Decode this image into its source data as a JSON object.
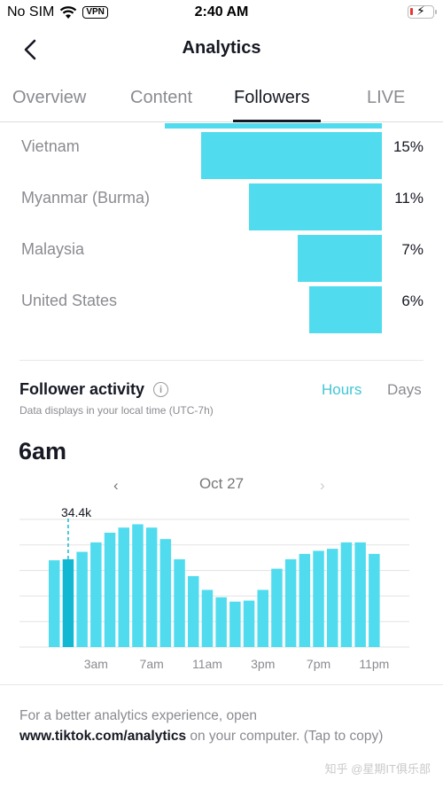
{
  "status_bar": {
    "carrier": "No SIM",
    "wifi_icon": "wifi-icon",
    "vpn": "VPN",
    "time": "2:40 AM",
    "battery_icon": "battery-charging-icon",
    "battery_level_fraction": 0.1,
    "bolt": "⚡"
  },
  "nav": {
    "back_icon": "chevron-left-icon",
    "title": "Analytics"
  },
  "tabs": [
    {
      "label": "Overview",
      "active": false
    },
    {
      "label": "Content",
      "active": false
    },
    {
      "label": "Followers",
      "active": true
    },
    {
      "label": "LIVE",
      "active": false
    }
  ],
  "top_countries": {
    "accent": "#50dcee",
    "items": [
      {
        "name": "",
        "pct_value": 18,
        "pct": ""
      },
      {
        "name": "Vietnam",
        "pct_value": 15,
        "pct": "15%"
      },
      {
        "name": "Myanmar (Burma)",
        "pct_value": 11,
        "pct": "11%"
      },
      {
        "name": "Malaysia",
        "pct_value": 7,
        "pct": "7%"
      },
      {
        "name": "United States",
        "pct_value": 6,
        "pct": "6%"
      }
    ]
  },
  "follower_activity": {
    "title": "Follower activity",
    "info_icon": "info-icon",
    "info_glyph": "i",
    "subtitle": "Data displays in your local time (UTC-7h)",
    "toggle_hours": "Hours",
    "toggle_days": "Days",
    "selected_toggle": "Hours",
    "accent": "#42c6d4",
    "selected_time": "6am",
    "date": "Oct 27",
    "prev_glyph": "‹",
    "next_glyph": "›"
  },
  "chart_data": {
    "type": "bar",
    "title": "Follower activity",
    "xlabel": "",
    "ylabel": "",
    "categories": [
      "12am",
      "1am",
      "2am",
      "3am",
      "4am",
      "5am",
      "6am",
      "7am",
      "8am",
      "9am",
      "10am",
      "11am",
      "12pm",
      "1pm",
      "2pm",
      "3pm",
      "4pm",
      "5pm",
      "6pm",
      "7pm",
      "8pm",
      "9pm",
      "10pm",
      "11pm"
    ],
    "values": [
      34.0,
      34.4,
      37.3,
      41.0,
      44.8,
      46.8,
      48.1,
      46.8,
      42.3,
      34.4,
      27.8,
      22.4,
      19.5,
      17.8,
      18.2,
      22.4,
      30.7,
      34.4,
      36.5,
      37.7,
      38.5,
      41.0,
      41.0,
      36.5
    ],
    "unit": "k",
    "tick_labels": [
      "3am",
      "7am",
      "11am",
      "3pm",
      "7pm",
      "11pm"
    ],
    "tick_indices": [
      3,
      7,
      11,
      15,
      19,
      23
    ],
    "highlight_index": 1,
    "highlight_label": "34.4k",
    "ylim": [
      0,
      60
    ],
    "grid": true,
    "grid_lines": 5,
    "bar_color": "#50dcee",
    "highlight_color": "#12b8d2"
  },
  "footer": {
    "text_before": "For a better analytics experience, open ",
    "link": "www.tiktok.com/analytics",
    "text_after": " on your computer. (Tap to copy)"
  },
  "watermark": "知乎 @星期IT俱乐部"
}
